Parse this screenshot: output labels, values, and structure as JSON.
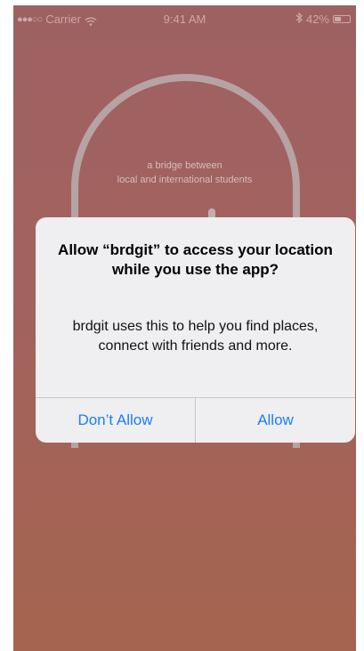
{
  "status_bar": {
    "signal": "●●●○○",
    "carrier": "Carrier",
    "wifi_icon": "wifi-icon",
    "time": "9:41 AM",
    "bluetooth_icon": "bluetooth-icon",
    "battery": "42%",
    "battery_level": 0.42
  },
  "background": {
    "tagline_line1": "a bridge between",
    "tagline_line2": "local and international students"
  },
  "alert": {
    "title": "Allow “brdgit” to access your location while you use the app?",
    "message": "brdgit uses this to help you find places, connect with friends and more.",
    "dont_allow_label": "Don’t Allow",
    "allow_label": "Allow"
  },
  "colors": {
    "accent": "#1b7ff5",
    "background_top": "#9e6162",
    "background_bottom": "#a5644f"
  }
}
